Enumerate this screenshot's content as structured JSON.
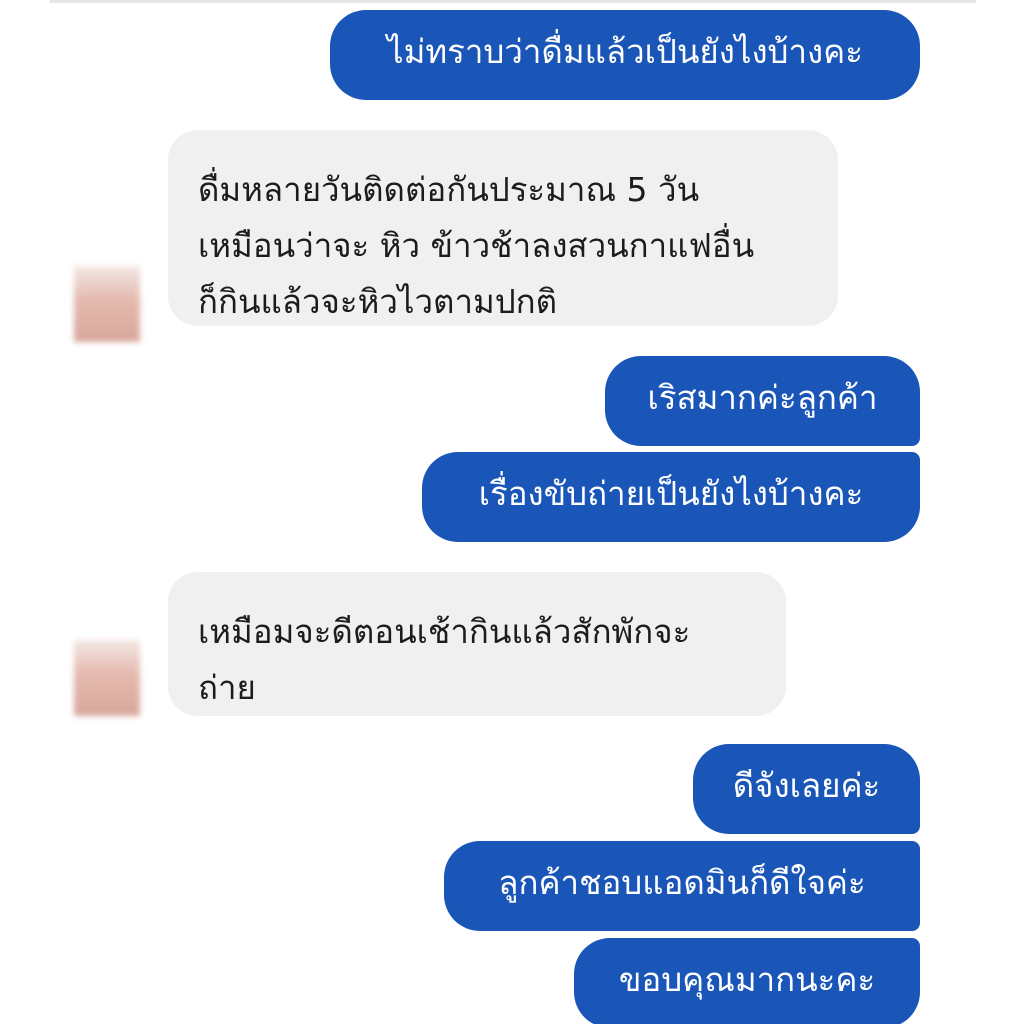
{
  "messages": [
    {
      "side": "outgoing",
      "text": "ไม่ทราบว่าดื่มแล้วเป็นยังไงบ้างคะ"
    },
    {
      "side": "incoming",
      "lines": [
        "ดื่มหลายวันติดต่อกันประมาณ 5 วัน",
        "เหมือนว่าจะ หิว ข้าวช้าลงสวนกาแฟอื่น",
        "ก็กินแล้วจะหิวไวตามปกติ"
      ]
    },
    {
      "side": "outgoing",
      "text": "เริสมากค่ะลูกค้า"
    },
    {
      "side": "outgoing",
      "text": "เรื่องขับถ่ายเป็นยังไงบ้างคะ"
    },
    {
      "side": "incoming",
      "lines": [
        "เหมือมจะดีตอนเช้ากินแล้วสักพักจะ",
        "ถ่าย"
      ]
    },
    {
      "side": "outgoing",
      "text": "ดีจังเลยค่ะ"
    },
    {
      "side": "outgoing",
      "text": "ลูกค้าชอบแอดมินก็ดีใจค่ะ"
    },
    {
      "side": "outgoing",
      "text": "ขอบคุณมากนะคะ"
    }
  ],
  "colors": {
    "outgoing_bubble": "#1a55b8",
    "incoming_bubble": "#f0f0f0",
    "outgoing_text": "#ffffff",
    "incoming_text": "#1c1c1c"
  }
}
